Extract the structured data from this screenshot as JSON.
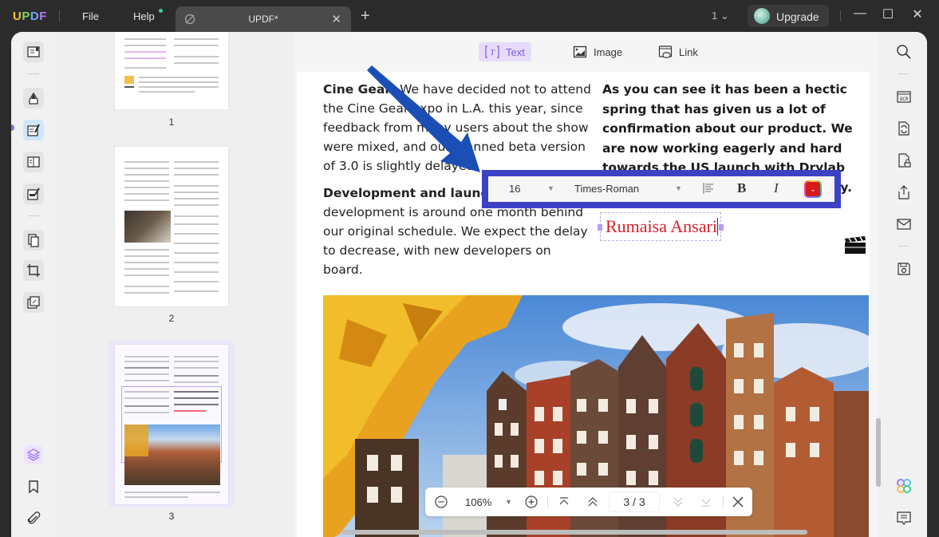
{
  "app": {
    "logo": [
      "U",
      "P",
      "D",
      "F"
    ],
    "menu": {
      "file": "File",
      "help": "Help"
    },
    "tab": {
      "title": "UPDF*",
      "close": "✕"
    },
    "new_tab": "+",
    "page_indicator": "1",
    "upgrade_label": "Upgrade",
    "window": {
      "minimize": "—",
      "maximize": "☐",
      "close": "✕"
    }
  },
  "edit_toolbar": {
    "items": [
      {
        "label": "Text",
        "icon": "text-box-icon",
        "active": true
      },
      {
        "label": "Image",
        "icon": "image-icon",
        "active": false
      },
      {
        "label": "Link",
        "icon": "link-icon",
        "active": false
      }
    ]
  },
  "thumbnails": [
    {
      "page": "1"
    },
    {
      "page": "2"
    },
    {
      "page": "3",
      "selected": true
    }
  ],
  "document": {
    "left_column": [
      {
        "heading": "Cine Gear:",
        "body": " We have decided not to attend the Cine Gear expo in L.A. this year, since feedback from many users about the show were mixed, and our planned beta version of 3.0 is slightly delayed."
      },
      {
        "heading": "Development and launch:",
        "body": " The development is around one month behind our original schedule. We expect the delay to decrease, with new developers on board."
      }
    ],
    "right_column": "As you can see it has been a hectic spring that has given us a lot of confirmation about our product. We are now working eagerly and hard towards the US launch with Drylab 3.0 expected to be released by July.",
    "signature_text": "Rumaisa Ansari"
  },
  "format_toolbar": {
    "font_size": "16",
    "font_family": "Times-Roman",
    "bold": "B",
    "italic": "I",
    "text_color": "#d71a1a",
    "highlight_border_color": "#3b42c4"
  },
  "nav_bar": {
    "zoom": "106%",
    "current_page": "3",
    "total_pages": "3",
    "page_display": "3 / 3"
  },
  "colors": {
    "accent": "#7a5ad8",
    "annotation_arrow": "#1b4fb5"
  }
}
